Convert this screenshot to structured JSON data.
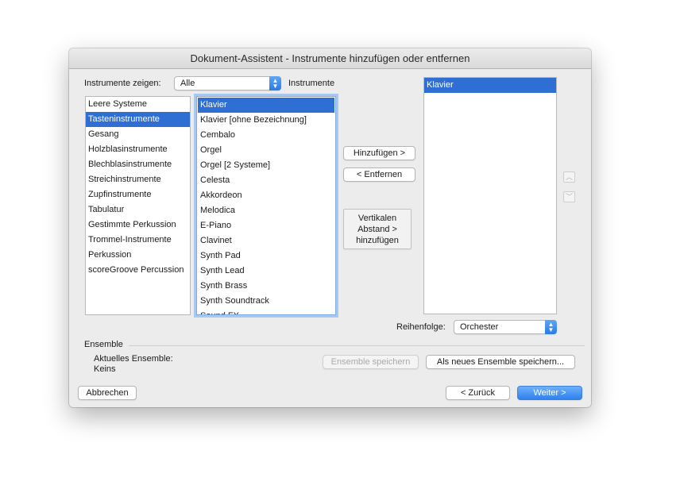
{
  "window": {
    "title": "Dokument-Assistent - Instrumente hinzufügen oder entfernen"
  },
  "filter": {
    "label": "Instrumente zeigen:",
    "value": "Alle"
  },
  "instruments_heading": "Instrumente",
  "categories": [
    {
      "label": "Leere Systeme",
      "selected": false
    },
    {
      "label": "Tasteninstrumente",
      "selected": true
    },
    {
      "label": "Gesang",
      "selected": false
    },
    {
      "label": "Holzblasinstrumente",
      "selected": false
    },
    {
      "label": "Blechblasinstrumente",
      "selected": false
    },
    {
      "label": "Streichinstrumente",
      "selected": false
    },
    {
      "label": "Zupfinstrumente",
      "selected": false
    },
    {
      "label": "Tabulatur",
      "selected": false
    },
    {
      "label": "Gestimmte Perkussion",
      "selected": false
    },
    {
      "label": "Trommel-Instrumente",
      "selected": false
    },
    {
      "label": "Perkussion",
      "selected": false
    },
    {
      "label": "scoreGroove Percussion",
      "selected": false
    }
  ],
  "instruments": [
    {
      "label": "Klavier",
      "selected": true
    },
    {
      "label": "Klavier [ohne Bezeichnung]",
      "selected": false
    },
    {
      "label": "Cembalo",
      "selected": false
    },
    {
      "label": "Orgel",
      "selected": false
    },
    {
      "label": "Orgel [2 Systeme]",
      "selected": false
    },
    {
      "label": "Celesta",
      "selected": false
    },
    {
      "label": "Akkordeon",
      "selected": false
    },
    {
      "label": "Melodica",
      "selected": false
    },
    {
      "label": "E-Piano",
      "selected": false
    },
    {
      "label": "Clavinet",
      "selected": false
    },
    {
      "label": "Synth Pad",
      "selected": false
    },
    {
      "label": "Synth Lead",
      "selected": false
    },
    {
      "label": "Synth Brass",
      "selected": false
    },
    {
      "label": "Synth Soundtrack",
      "selected": false
    },
    {
      "label": "Sound FX",
      "selected": false
    }
  ],
  "selected_instruments": [
    {
      "label": "Klavier",
      "selected": true
    }
  ],
  "buttons": {
    "add": "Hinzufügen >",
    "remove": "< Entfernen",
    "add_spacing": [
      "Vertikalen",
      "Abstand >",
      "hinzufügen"
    ],
    "save_ensemble": "Ensemble speichern",
    "save_new_ensemble": "Als neues Ensemble speichern...",
    "cancel": "Abbrechen",
    "back": "< Zurück",
    "next": "Weiter >"
  },
  "order": {
    "label": "Reihenfolge:",
    "value": "Orchester"
  },
  "ensemble": {
    "heading": "Ensemble",
    "current_label": "Aktuelles Ensemble:",
    "current_value": "Keins"
  },
  "icons": {
    "move_up": "chevron-up-icon",
    "move_down": "chevron-down-icon",
    "popup_stepper": "up-down-arrows-icon"
  }
}
